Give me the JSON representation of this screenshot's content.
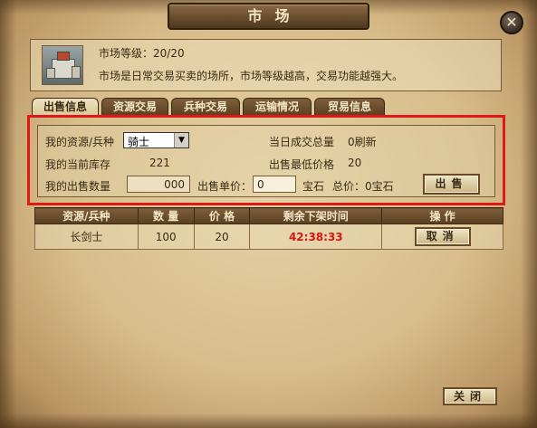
{
  "window": {
    "title": "市场",
    "close_label": "✕"
  },
  "info": {
    "level_text": "市场等级：20/20",
    "description": "市场是日常交易买卖的场所，市场等级越高，交易功能越强大。"
  },
  "tabs": [
    "出售信息",
    "资源交易",
    "兵种交易",
    "运输情况",
    "贸易信息"
  ],
  "form": {
    "resource_label": "我的资源/兵种",
    "resource_selected": "骑士",
    "stock_label": "我的当前库存",
    "stock_value": "221",
    "sell_qty_label": "我的出售数量",
    "sell_qty_value": "000",
    "unit_price_label": "出售单价：",
    "unit_price_value": "0",
    "unit_price_unit": "宝石",
    "total_label": "总价：0宝石",
    "today_volume_label": "当日成交总量",
    "today_volume_value": "0刷新",
    "min_price_label": "出售最低价格",
    "min_price_value": "20",
    "sell_button": "出售"
  },
  "table": {
    "headers": [
      "资源/兵种",
      "数 量",
      "价 格",
      "剩余下架时间",
      "操 作"
    ],
    "rows": [
      {
        "item": "长剑士",
        "qty": "100",
        "price": "20",
        "time_left": "42:38:33",
        "action": "取消"
      }
    ]
  },
  "footer": {
    "close_button": "关闭"
  },
  "colors": {
    "highlight_border": "#e01818",
    "timer": "#d81414"
  }
}
